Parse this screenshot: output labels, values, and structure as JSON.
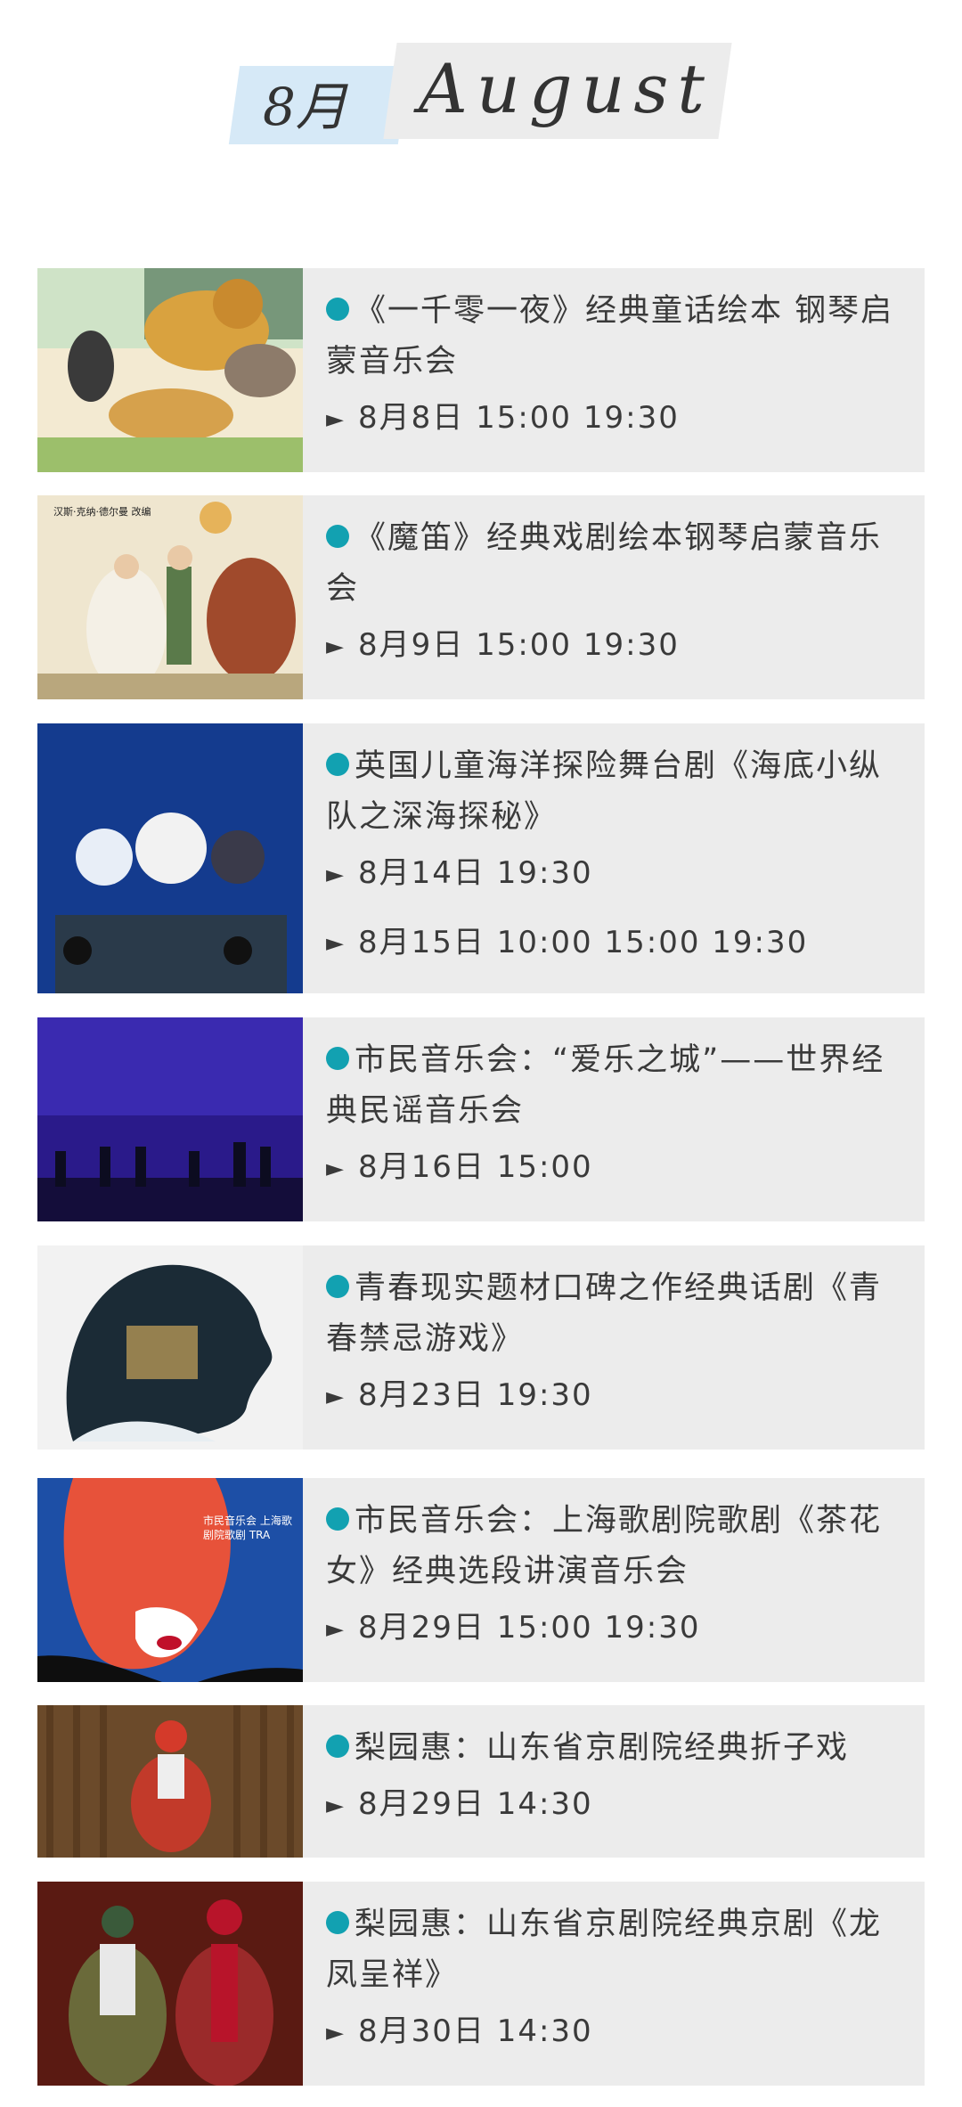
{
  "header": {
    "month_cn": "8月",
    "month_en": "August"
  },
  "events": [
    {
      "title": "《一千零一夜》经典童话绘本 钢琴启蒙音乐会",
      "times": [
        "8月8日 15:00 19:30"
      ]
    },
    {
      "title": "《魔笛》经典戏剧绘本钢琴启蒙音乐会",
      "image_caption": "汉斯·克纳·德尔曼 改编",
      "times": [
        "8月9日 15:00 19:30"
      ]
    },
    {
      "title": "英国儿童海洋探险舞台剧《海底小纵队之深海探秘》",
      "times": [
        "8月14日 19:30",
        "8月15日  10:00 15:00 19:30"
      ]
    },
    {
      "title": "市民音乐会：“爱乐之城”——世界经典民谣音乐会",
      "times": [
        "8月16日  15:00"
      ]
    },
    {
      "title": "青春现实题材口碑之作经典话剧《青春禁忌游戏》",
      "times": [
        "8月23日  19:30"
      ]
    },
    {
      "title": "市民音乐会：上海歌剧院歌剧《茶花女》经典选段讲演音乐会",
      "image_caption": "市民音乐会 上海歌剧院歌剧 TRA",
      "times": [
        "8月29日  15:00 19:30"
      ]
    },
    {
      "title": "梨园惠：山东省京剧院经典折子戏",
      "times": [
        "8月29日 14:30"
      ]
    },
    {
      "title": "梨园惠：山东省京剧院经典京剧《龙凤呈祥》",
      "times": [
        "8月30日  14:30"
      ]
    }
  ],
  "colors": {
    "accent_dot": "#12a1b1",
    "card_bg": "#ececec",
    "month_box": "#d6e9f7"
  }
}
